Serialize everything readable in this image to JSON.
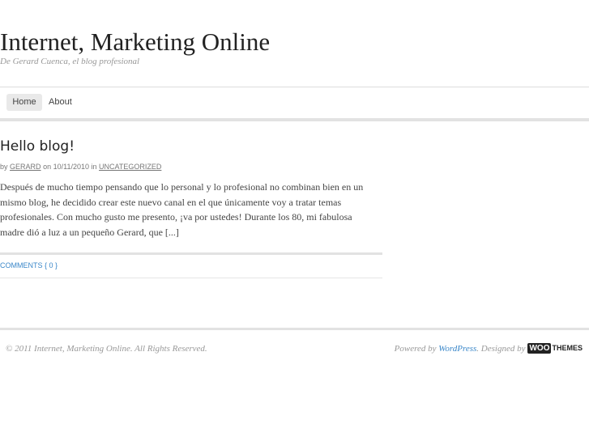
{
  "header": {
    "site_title": "Internet, Marketing Online",
    "site_description": "De Gerard Cuenca, el blog profesional"
  },
  "nav": {
    "items": [
      {
        "label": "Home",
        "active": true
      },
      {
        "label": "About",
        "active": false
      }
    ]
  },
  "post": {
    "title": "Hello blog!",
    "meta": {
      "by_text": "by",
      "author": "Gerard",
      "on_text": "on",
      "date": "10/11/2010",
      "in_text": "in",
      "category": "Uncategorized"
    },
    "excerpt": "Después de mucho tiempo pensando que lo personal y lo profesional no combinan bien en un mismo blog, he decidido crear este nuevo canal en el que únicamente voy a tratar temas profesionales. Con mucho gusto me presento, ¡va por ustedes! Durante los 80, mi fabulosa madre dió a luz a un pequeño Gerard, que [...]",
    "comments_label": "Comments { 0 }"
  },
  "footer": {
    "copyright": "© 2011 Internet, Marketing Online. All Rights Reserved.",
    "powered_by_text": "Powered by",
    "wordpress_link": "WordPress",
    "designed_by_text": ". Designed by",
    "woo_logo_box": "WOO",
    "woo_logo_text": "THEMES"
  },
  "colors": {
    "link": "#3a87c9",
    "nav_active_bg": "#e9e9e9",
    "rule": "#e2e2e2"
  }
}
